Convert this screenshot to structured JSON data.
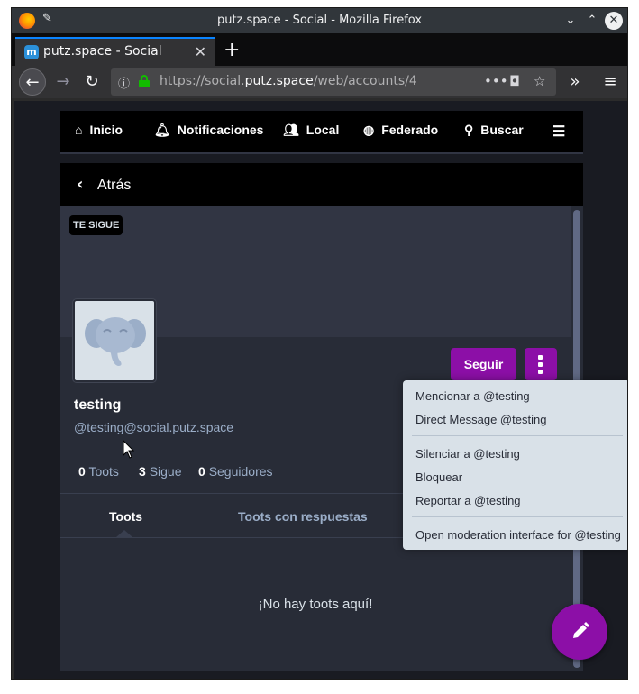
{
  "window": {
    "title": "putz.space - Social - Mozilla Firefox"
  },
  "browser": {
    "tab_title": "putz.space - Social",
    "favicon_letter": "m",
    "url_prefix": "https://social.",
    "url_host": "putz.space",
    "url_path": "/web/accounts/4"
  },
  "topnav": {
    "home": "Inicio",
    "notifications": "Notificaciones",
    "local": "Local",
    "federated": "Federado",
    "search": "Buscar"
  },
  "column": {
    "back_label": "Atrás"
  },
  "profile": {
    "follows_you_badge": "TE SIGUE",
    "display_name": "testing",
    "acct": "@testing@social.putz.space",
    "follow_button": "Seguir",
    "toots_count": "0",
    "toots_label": "Toots",
    "following_count": "3",
    "following_label": "Sigue",
    "followers_count": "0",
    "followers_label": "Seguidores"
  },
  "tabs": {
    "toots": "Toots",
    "toots_replies": "Toots con respuestas"
  },
  "empty_message": "¡No hay toots aquí!",
  "menu": {
    "mention": "Mencionar a @testing",
    "direct": "Direct Message @testing",
    "mute": "Silenciar a @testing",
    "block": "Bloquear",
    "report": "Reportar a @testing",
    "moderation": "Open moderation interface for @testing"
  },
  "colors": {
    "accent": "#8c0fa7",
    "column_bg": "#282c37",
    "menu_bg": "#d9e1e8"
  }
}
